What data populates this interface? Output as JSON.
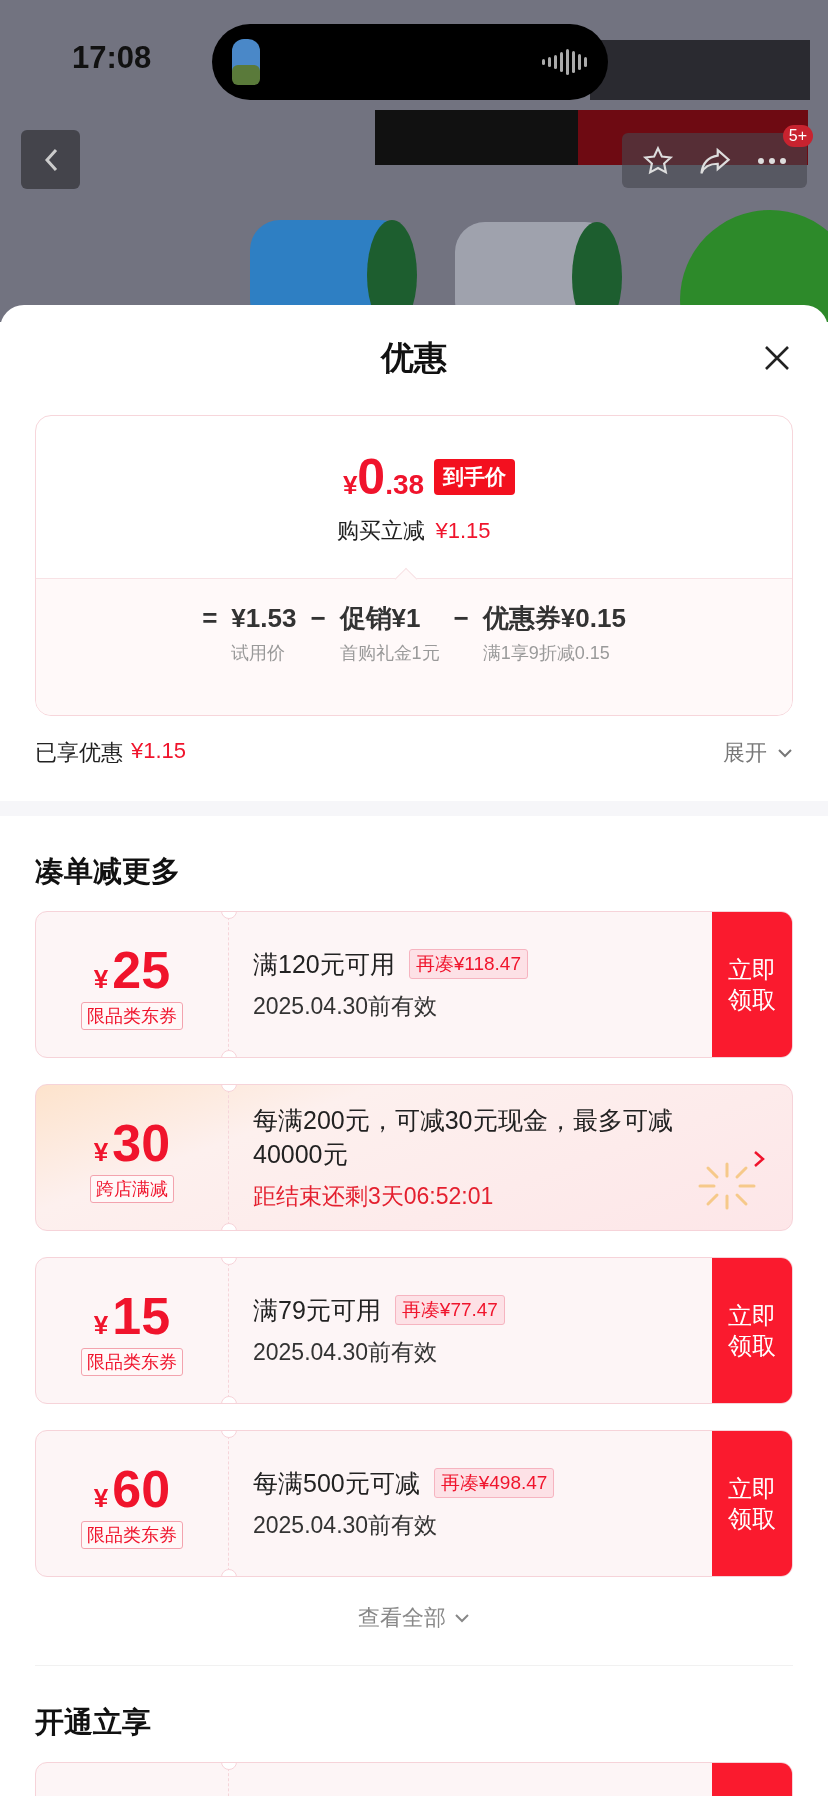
{
  "status_bar": {
    "time": "17:08"
  },
  "header": {
    "badge": "5+"
  },
  "sheet": {
    "title": "优惠",
    "price_card": {
      "currency": "¥",
      "price_int": "0",
      "price_dec": ".38",
      "price_tag": "到手价",
      "saving_label": "购买立减",
      "saving_value": "¥1.15",
      "breakdown": [
        {
          "operator": "=",
          "amount": "¥1.53",
          "note": "试用价"
        },
        {
          "operator": "−",
          "amount": "促销¥1",
          "note": "首购礼金1元"
        },
        {
          "operator": "−",
          "amount": "优惠券¥0.15",
          "note": "满1享9折减0.15"
        }
      ]
    },
    "enjoyed": {
      "label": "已享优惠",
      "value": "¥1.15",
      "expand": "展开"
    }
  },
  "more_section": {
    "title": "凑单减更多",
    "coupons": [
      {
        "kind": "coupon",
        "currency": "¥",
        "amount": "25",
        "tag": "限品类东券",
        "condition": "满120元可用",
        "gap": "再凑¥118.47",
        "validity": "2025.04.30前有效",
        "button": "立即领取"
      },
      {
        "kind": "promo",
        "currency": "¥",
        "amount": "30",
        "tag": "跨店满减",
        "description": "每满200元，可减30元现金，最多可减40000元",
        "countdown": "距结束还剩3天06:52:01"
      },
      {
        "kind": "coupon",
        "currency": "¥",
        "amount": "15",
        "tag": "限品类东券",
        "condition": "满79元可用",
        "gap": "再凑¥77.47",
        "validity": "2025.04.30前有效",
        "button": "立即领取"
      },
      {
        "kind": "coupon",
        "currency": "¥",
        "amount": "60",
        "tag": "限品类东券",
        "condition": "每满500元可减",
        "gap": "再凑¥498.47",
        "validity": "2025.04.30前有效",
        "button": "立即领取"
      }
    ],
    "view_all": "查看全部"
  },
  "join_section": {
    "title": "开通立享",
    "coupons": [
      {
        "kind": "coupon"
      }
    ]
  }
}
